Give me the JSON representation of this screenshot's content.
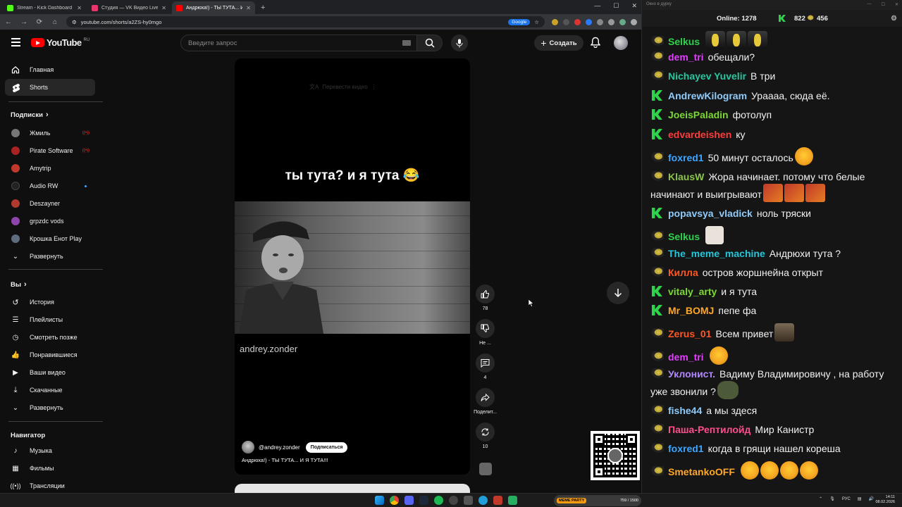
{
  "browser": {
    "tabs": [
      {
        "title": "Stream - Kick Dashboard",
        "color": "#53fc18"
      },
      {
        "title": "Студия — VK Видео Live",
        "color": "#e8356b"
      },
      {
        "title": "Андрюха!) - ТЫ ТУТА... И Я",
        "color": "#ff0000"
      }
    ],
    "url": "youtube.com/shorts/a2ZS-hy0mgo",
    "google_chip": "Google"
  },
  "youtube": {
    "logo": "YouTube",
    "region": "RU",
    "search_placeholder": "Введите запрос",
    "create_label": "Создать",
    "sidebar": {
      "main": [
        {
          "label": "Главная",
          "icon": "home-icon"
        },
        {
          "label": "Shorts",
          "icon": "shorts-icon"
        }
      ],
      "subscriptions_title": "Подписки",
      "subscriptions": [
        {
          "label": "Жмиль",
          "color": "#777",
          "live": "((•))"
        },
        {
          "label": "Pirate Software",
          "color": "#aa2222",
          "live": "((•))"
        },
        {
          "label": "Amytrip",
          "color": "#c0392b"
        },
        {
          "label": "Audio RW",
          "color": "#222",
          "dot": true
        },
        {
          "label": "Deszayner",
          "color": "#b03a2e"
        },
        {
          "label": "grpzdc vods",
          "color": "#8e44ad"
        },
        {
          "label": "Крошка Енот Play",
          "color": "#5d6d7e"
        },
        {
          "label": "Развернуть",
          "icon": "chevron-down-icon"
        }
      ],
      "you_title": "Вы",
      "you": [
        {
          "label": "История",
          "icon": "history-icon"
        },
        {
          "label": "Плейлисты",
          "icon": "playlists-icon"
        },
        {
          "label": "Смотреть позже",
          "icon": "watch-later-icon"
        },
        {
          "label": "Понравившиеся",
          "icon": "like-icon"
        },
        {
          "label": "Ваши видео",
          "icon": "your-videos-icon"
        },
        {
          "label": "Скачанные",
          "icon": "download-icon"
        },
        {
          "label": "Развернуть",
          "icon": "chevron-down-icon"
        }
      ],
      "navigator_title": "Навигатор",
      "navigator": [
        {
          "label": "Музыка",
          "icon": "music-icon"
        },
        {
          "label": "Фильмы",
          "icon": "movies-icon"
        },
        {
          "label": "Трансляции",
          "icon": "live-icon"
        }
      ]
    },
    "short": {
      "translate": "Перевести видео",
      "caption": "ты тута? и я тута 😂",
      "watermark": "andrey.zonder",
      "channel": "@andrey.zonder",
      "subscribe": "Подписаться",
      "title": "Андрюха!) - ТЫ ТУТА... И Я ТУТА!!!"
    },
    "actions": {
      "likes": "78",
      "dislike": "Не ...",
      "comments": "4",
      "share": "Поделит...",
      "remix": "10"
    }
  },
  "chat": {
    "window_title": "Окно в дурку",
    "online_label": "Online:",
    "online": "1278",
    "kick_count": "822",
    "yt_count": "456",
    "messages": [
      {
        "src": "yt",
        "nick": "Selkus",
        "color": "#2fd34b",
        "text": "",
        "emotes": [
          "gold",
          "gold",
          "gold"
        ]
      },
      {
        "src": "yt",
        "nick": "dem_tri",
        "color": "#e040fb",
        "text": "обещали?"
      },
      {
        "src": "yt",
        "nick": "Nichayev Yuvelir",
        "color": "#26c6a0",
        "text": "В три"
      },
      {
        "src": "kick",
        "nick": "AndrewKilogram",
        "color": "#90caf9",
        "text": "Ураааа, сюда её."
      },
      {
        "src": "kick",
        "nick": "JoeisPaladin",
        "color": "#7cd832",
        "text": "фотолуп"
      },
      {
        "src": "kick",
        "nick": "edvardeishen",
        "color": "#ff3b3b",
        "text": "ку"
      },
      {
        "src": "yt",
        "nick": "foxred1",
        "color": "#3ea6ff",
        "text": "50 минут осталось",
        "emotes": [
          "round"
        ]
      },
      {
        "src": "yt",
        "nick": "KlausW",
        "color": "#8bc34a",
        "text": "Жора начинает. потому что белые начинают и выигрывают",
        "emotes": [
          "square",
          "square",
          "square"
        ]
      },
      {
        "src": "kick",
        "nick": "popavsya_vladick",
        "color": "#90caf9",
        "text": "ноль тряски"
      },
      {
        "src": "yt",
        "nick": "Selkus",
        "color": "#2fd34b",
        "text": "",
        "emotes": [
          "cat"
        ]
      },
      {
        "src": "yt",
        "nick": "The_meme_machine",
        "color": "#26c6da",
        "text": "Андрюхи тута ?"
      },
      {
        "src": "yt",
        "nick": "Килла",
        "color": "#ff5722",
        "text": "остров жоршнейна открыт"
      },
      {
        "src": "kick",
        "nick": "vitaly_arty",
        "color": "#7cd832",
        "text": "и я тута"
      },
      {
        "src": "kick",
        "nick": "Mr_BOMJ",
        "color": "#ffa726",
        "text": "пепе фа"
      },
      {
        "src": "yt",
        "nick": "Zerus_01",
        "color": "#ff5722",
        "text": "Всем привет",
        "emotes": [
          "face"
        ]
      },
      {
        "src": "yt",
        "nick": "dem_tri",
        "color": "#e040fb",
        "text": "",
        "emotes": [
          "round"
        ]
      },
      {
        "src": "yt",
        "nick": "Уклонист.",
        "color": "#b388ff",
        "text": "Вадиму Владимировичу , на работу уже звонили ?",
        "emotes": [
          "fish"
        ]
      },
      {
        "src": "yt",
        "nick": "fishe44",
        "color": "#90caf9",
        "text": "а мы здеся"
      },
      {
        "src": "yt",
        "nick": "Паша-Рептилойд",
        "color": "#ff4d8d",
        "text": "Мир Канистр"
      },
      {
        "src": "yt",
        "nick": "foxred1",
        "color": "#3ea6ff",
        "text": "когда в грящи нашел кореша"
      },
      {
        "src": "yt",
        "nick": "SmetankoOFF",
        "color": "#ffa726",
        "text": "",
        "emotes": [
          "round",
          "round",
          "round",
          "round"
        ]
      }
    ]
  },
  "taskbar": {
    "meme_party": "MEME PARTY",
    "meme_count": "759 / 1500",
    "lang": "РУС",
    "time": "14:11",
    "date": "08.02.2026"
  }
}
